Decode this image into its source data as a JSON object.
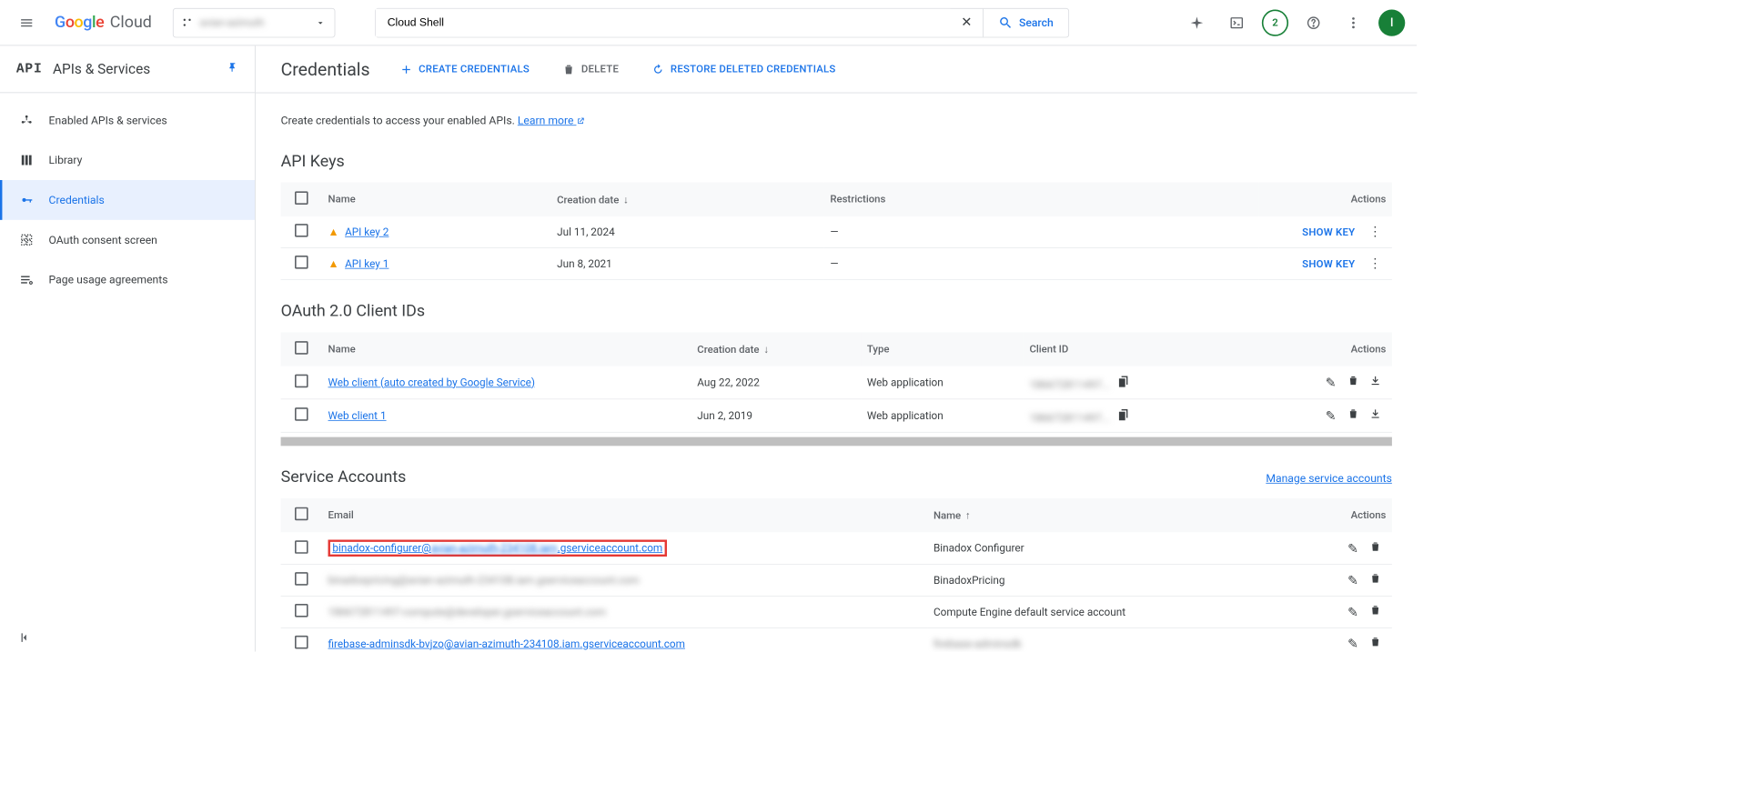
{
  "header": {
    "logo_google": "Google",
    "logo_cloud": "Cloud",
    "project_name": "avian-azimuth",
    "search_value": "Cloud Shell",
    "search_button": "Search",
    "notification_count": "2",
    "avatar_letter": "I"
  },
  "sidebar": {
    "logo": "API",
    "title": "APIs & Services",
    "items": [
      {
        "label": "Enabled APIs & services",
        "active": false
      },
      {
        "label": "Library",
        "active": false
      },
      {
        "label": "Credentials",
        "active": true
      },
      {
        "label": "OAuth consent screen",
        "active": false
      },
      {
        "label": "Page usage agreements",
        "active": false
      }
    ]
  },
  "toolbar": {
    "title": "Credentials",
    "create": "CREATE CREDENTIALS",
    "delete": "DELETE",
    "restore": "RESTORE DELETED CREDENTIALS"
  },
  "helper": {
    "text": "Create credentials to access your enabled APIs. ",
    "link": "Learn more"
  },
  "apikeys": {
    "title": "API Keys",
    "cols": {
      "name": "Name",
      "created": "Creation date",
      "restrictions": "Restrictions",
      "actions": "Actions"
    },
    "showkey": "SHOW KEY",
    "rows": [
      {
        "name": "API key 2",
        "created": "Jul 11, 2024",
        "restrictions": "—"
      },
      {
        "name": "API key 1",
        "created": "Jun 8, 2021",
        "restrictions": "—"
      }
    ]
  },
  "oauth": {
    "title": "OAuth 2.0 Client IDs",
    "cols": {
      "name": "Name",
      "created": "Creation date",
      "type": "Type",
      "clientid": "Client ID",
      "actions": "Actions"
    },
    "rows": [
      {
        "name": "Web client (auto created by Google Service)",
        "created": "Aug 22, 2022",
        "type": "Web application",
        "clientid": "186672811497...   "
      },
      {
        "name": "Web client 1",
        "created": "Jun 2, 2019",
        "type": "Web application",
        "clientid": "186672811497...   "
      }
    ]
  },
  "svc": {
    "title": "Service Accounts",
    "manage": "Manage service accounts",
    "cols": {
      "email": "Email",
      "name": "Name",
      "actions": "Actions"
    },
    "rows": [
      {
        "email_pre": "binadox-configurer@",
        "email_mid": "avian-azimuth-234108.iam",
        "email_suf": ".gserviceaccount.com",
        "name": "Binadox Configurer",
        "blur": false,
        "highlight": true
      },
      {
        "email_pre": "binadoxpricing@avian-azimuth-234108.iam.gserviceaccount.com",
        "email_mid": "",
        "email_suf": "",
        "name": "BinadoxPricing",
        "blur": true
      },
      {
        "email_pre": "186672811497-compute@developer.gserviceaccount.com",
        "email_mid": "",
        "email_suf": "",
        "name": "Compute Engine default service account",
        "blur": true
      },
      {
        "email_pre": "firebase-adminsdk-bvjzo@avian-azimuth-234108.iam.gserviceaccount.com",
        "email_mid": "",
        "email_suf": "",
        "name": "firebase-adminsdk",
        "blur": false,
        "partial": true
      }
    ]
  }
}
